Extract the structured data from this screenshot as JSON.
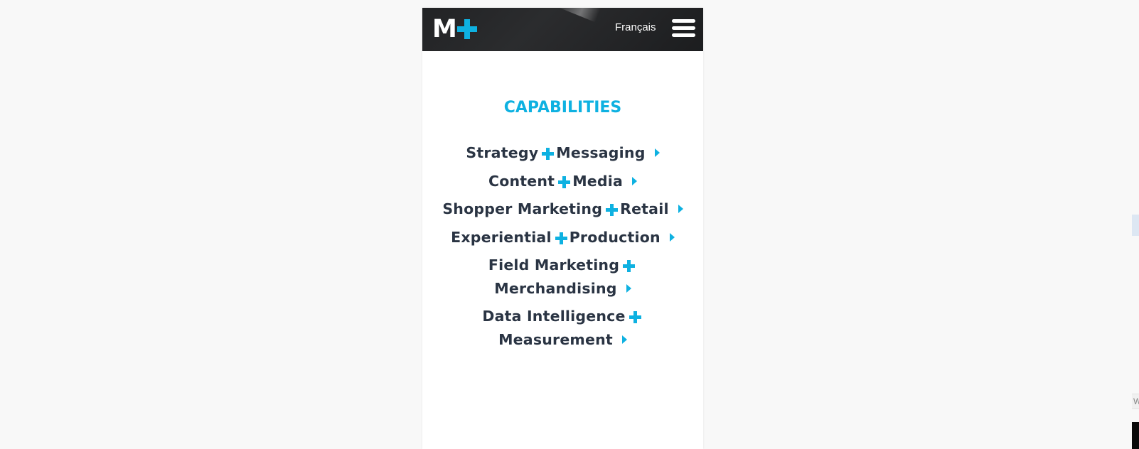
{
  "colors": {
    "accent": "#0eb1e1",
    "heading_text": "#2a3443",
    "header_bg": "#232426",
    "header_text": "#ffffff",
    "page_bg": "#f8f8f8"
  },
  "header": {
    "logo": {
      "letter": "M",
      "icon": "plus-icon"
    },
    "language_link": "Français",
    "menu_icon": "hamburger-menu-icon"
  },
  "main": {
    "section_title": "CAPABILITIES",
    "capabilities": [
      {
        "first": "Strategy",
        "second": "Messaging"
      },
      {
        "first": "Content",
        "second": "Media"
      },
      {
        "first": "Shopper Marketing",
        "second": "Retail"
      },
      {
        "first": "Experiential",
        "second": "Production"
      },
      {
        "first": "Field Marketing",
        "second": "Merchandising"
      },
      {
        "first": "Data Intelligence",
        "second": "Measurement"
      }
    ],
    "separator_icon": "plus-icon",
    "arrow_icon": "caret-right-icon"
  },
  "edge": {
    "partial_text": "W"
  }
}
